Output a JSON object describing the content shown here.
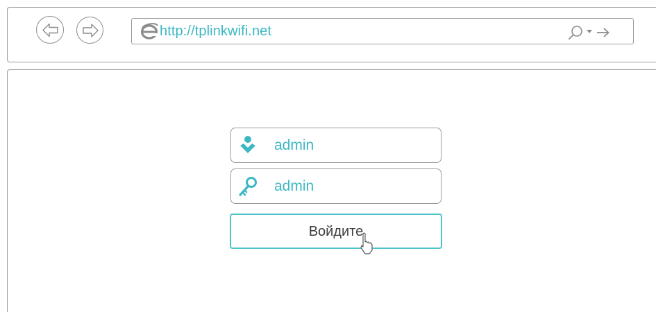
{
  "browser": {
    "url": "http://tplinkwifi.net",
    "icons": {
      "back": "back-arrow-icon",
      "forward": "forward-arrow-icon",
      "browser": "internet-explorer-icon",
      "search": "search-icon",
      "dropdown": "dropdown-icon",
      "go": "go-arrow-icon"
    }
  },
  "login": {
    "username_value": "admin",
    "password_value": "admin",
    "submit_label": "Войдите",
    "icons": {
      "username": "user-icon",
      "password": "key-icon"
    }
  },
  "colors": {
    "accent": "#3cb8c4",
    "button_border": "#4fc3cb",
    "border_gray": "#9a9a9a",
    "text_dark": "#3d3d3d"
  }
}
